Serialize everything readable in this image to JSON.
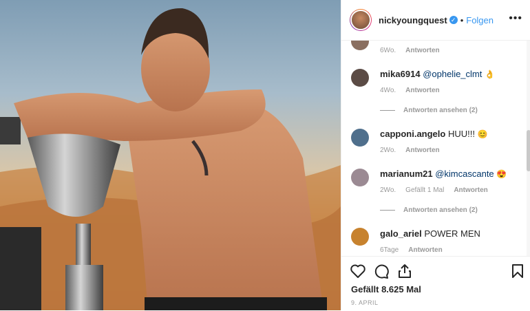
{
  "post_author": {
    "username": "nickyoungquest",
    "verified_glyph": "✓",
    "dot": "•",
    "follow_label": "Folgen"
  },
  "comments": [
    {
      "user": "",
      "text": "",
      "time": "6Wo.",
      "likes": "",
      "reply": "Antworten",
      "avatar_color": "#8a6f60"
    },
    {
      "user": "mika6914",
      "text": "@ophelie_clmt",
      "emoji": "👌",
      "time": "4Wo.",
      "likes": "",
      "reply": "Antworten",
      "thread": "Antworten ansehen (2)",
      "avatar_color": "#5b4b45"
    },
    {
      "user": "capponi.angelo",
      "text": "HUU!!!",
      "emoji": "😊",
      "time": "2Wo.",
      "likes": "",
      "reply": "Antworten",
      "avatar_color": "#4f6f8c"
    },
    {
      "user": "marianum21",
      "text": "@kimcascante",
      "emoji": "😍",
      "time": "2Wo.",
      "likes": "Gefällt 1 Mal",
      "reply": "Antworten",
      "thread": "Antworten ansehen (2)",
      "avatar_color": "#9b8a93"
    },
    {
      "user": "galo_ariel",
      "text": "POWER MEN",
      "emoji": "",
      "time": "6Tage",
      "likes": "",
      "reply": "Antworten",
      "avatar_color": "#c7822e"
    }
  ],
  "footer": {
    "likes_text": "Gefällt 8.625 Mal",
    "date": "9. April"
  },
  "icons": {
    "like": "heart-icon",
    "comment": "comment-icon",
    "share": "share-icon",
    "save": "bookmark-icon",
    "more": "more-options-icon"
  },
  "colors": {
    "link": "#3897f0",
    "mention": "#003569",
    "meta": "#999999"
  }
}
